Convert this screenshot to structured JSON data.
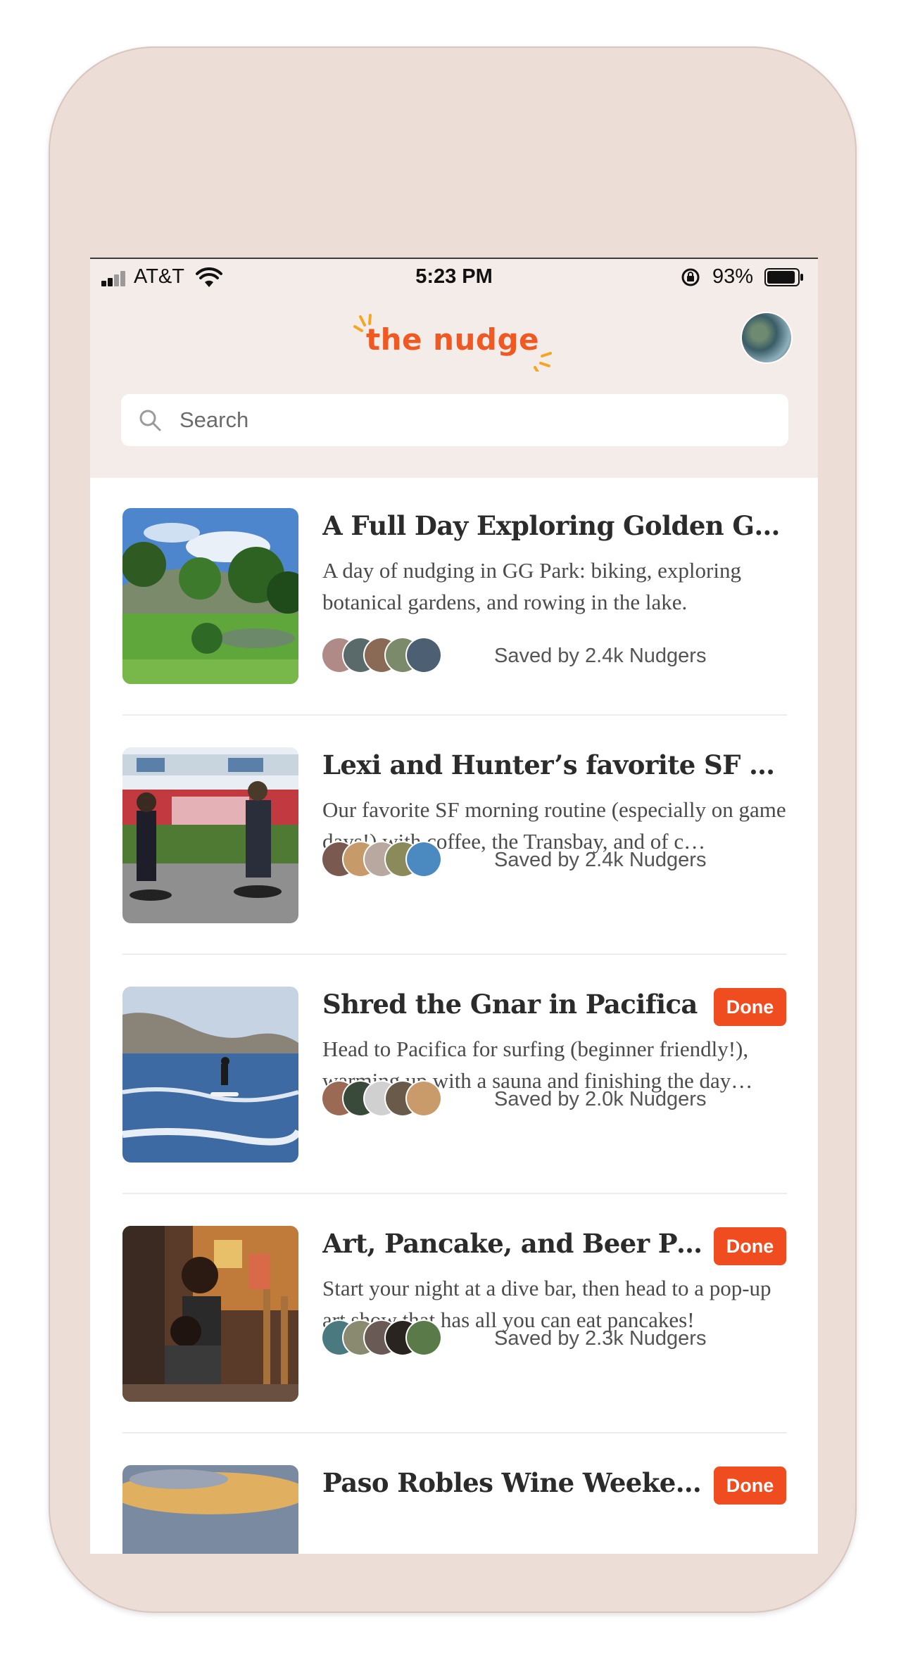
{
  "status_bar": {
    "carrier": "AT&T",
    "time": "5:23 PM",
    "battery_percent": "93%",
    "battery_level": 0.93
  },
  "header": {
    "logo_text": "the nudge",
    "search_placeholder": "Search"
  },
  "colors": {
    "brand": "#f05a22",
    "done_badge": "#ef4d1f",
    "header_bg": "#f4ece8",
    "device_frame": "#ecddd7"
  },
  "feed": [
    {
      "title": "A Full Day Exploring Golden Gat…",
      "description": "A day of nudging in GG Park: biking, exploring botanical gardens, and rowing in the lake.",
      "saved_text": "Saved by 2.4k Nudgers",
      "done_label": ""
    },
    {
      "title": "Lexi and Hunter’s favorite SF mo…",
      "description": "Our favorite SF morning routine (especially on game days!) with coffee, the Transbay, and of c…",
      "saved_text": "Saved by 2.4k Nudgers",
      "done_label": ""
    },
    {
      "title": "Shred the Gnar in Pacifica",
      "description": "Head to Pacifica for surfing (beginner friendly!), warming up with a sauna and finishing the day…",
      "saved_text": "Saved by 2.0k Nudgers",
      "done_label": "Done"
    },
    {
      "title": "Art, Pancake, and Beer Po…",
      "description": "Start your night at a dive bar, then head to a pop-up art show that has all you can eat pancakes!",
      "saved_text": "Saved by 2.3k Nudgers",
      "done_label": "Done"
    },
    {
      "title": "Paso Robles Wine Weekend",
      "description": "",
      "saved_text": "",
      "done_label": "Done"
    }
  ]
}
